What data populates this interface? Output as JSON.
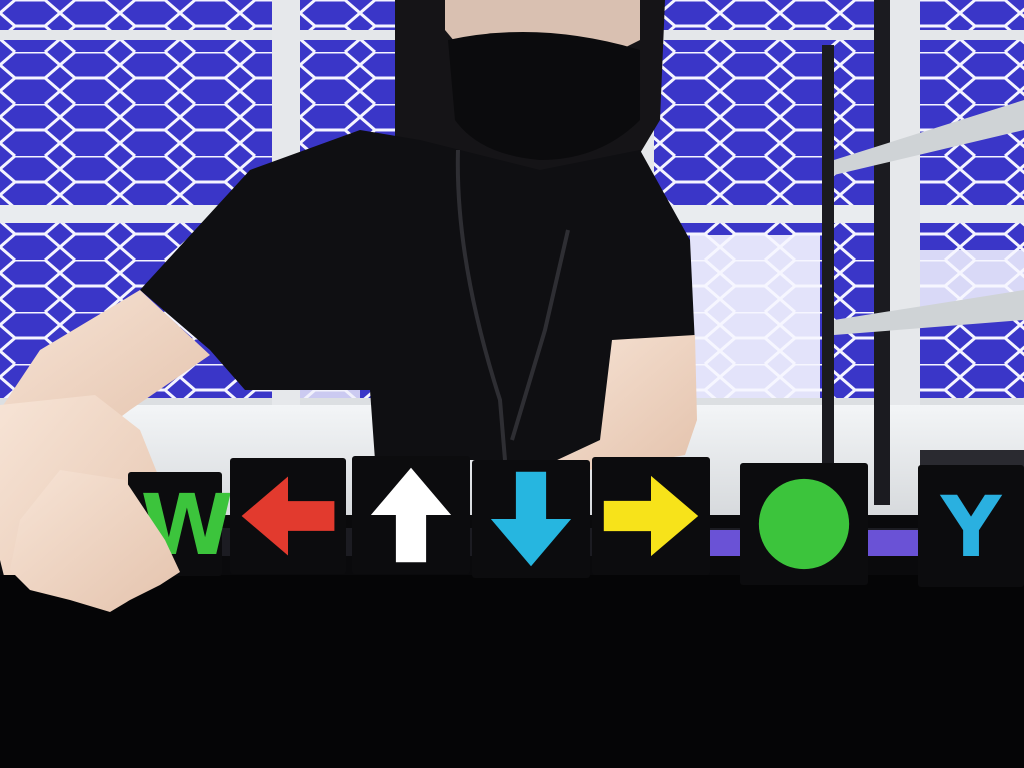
{
  "scene": {
    "description_free": true,
    "cards": [
      {
        "kind": "letter",
        "text": "W",
        "color": "#3cc43c"
      },
      {
        "kind": "arrow",
        "direction": "left",
        "color": "#e23a2e"
      },
      {
        "kind": "arrow",
        "direction": "up",
        "color": "#ffffff"
      },
      {
        "kind": "arrow",
        "direction": "down",
        "color": "#26b6e0"
      },
      {
        "kind": "arrow",
        "direction": "right",
        "color": "#f7e31a"
      },
      {
        "kind": "shape",
        "shape": "circle",
        "color": "#3cc43c"
      },
      {
        "kind": "letter",
        "text": "Y",
        "color": "#2ab0e0"
      }
    ],
    "colors": {
      "card_background": "#0c0c0e",
      "tabletop": "#050506",
      "wall": "#e8ecef",
      "window_tint": "#3b3acb",
      "track_accent": "#6a52d6",
      "shirt": "#0f0f12",
      "skin": "#f2d9c8"
    }
  }
}
